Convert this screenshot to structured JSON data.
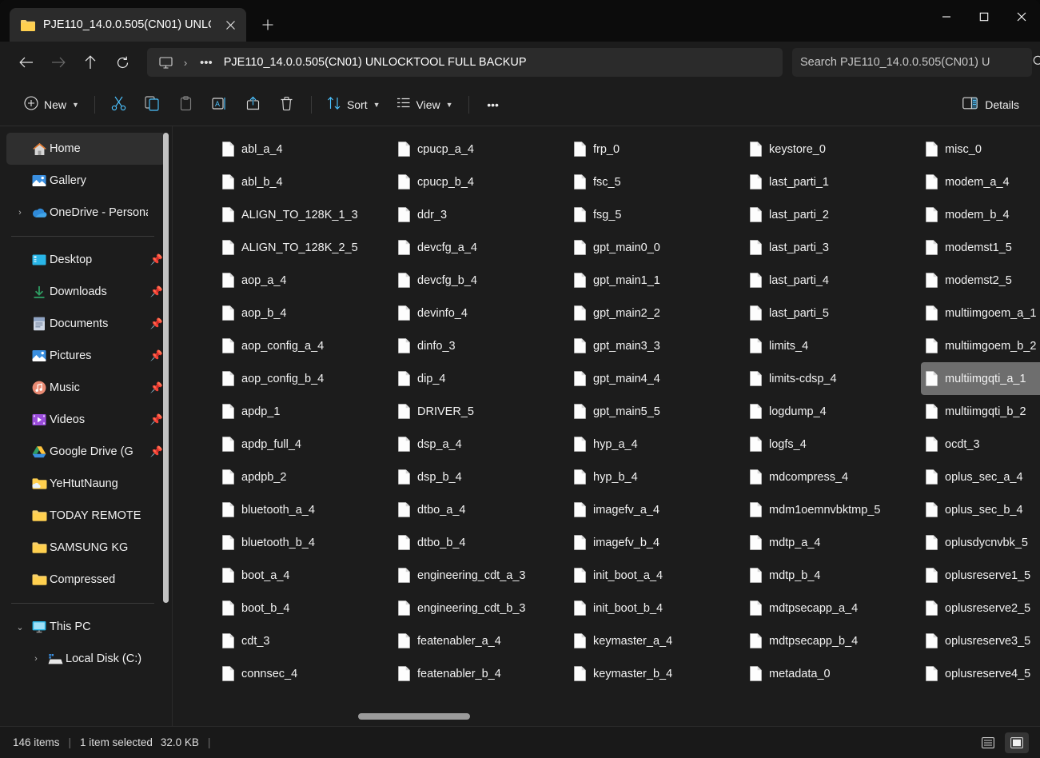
{
  "window": {
    "tab": {
      "title": "PJE110_14.0.0.505(CN01) UNLO",
      "folder_icon": "folder-icon",
      "close_icon": "close-icon"
    },
    "new_tab_label": "+",
    "controls": {
      "minimize": "minimize-icon",
      "maximize": "maximize-icon",
      "close": "close-icon"
    }
  },
  "nav": {
    "back": "arrow-left-icon",
    "forward": "arrow-right-icon",
    "up": "arrow-up-icon",
    "refresh": "refresh-icon",
    "breadcrumb_icon": "this-pc-icon",
    "breadcrumb_sep": "›",
    "breadcrumb_overflow": "•••",
    "breadcrumb_text": "PJE110_14.0.0.505(CN01) UNLOCKTOOL FULL BACKUP",
    "search_placeholder": "Search PJE110_14.0.0.505(CN01) U",
    "search_value": ""
  },
  "toolbar": {
    "new_label": "New",
    "cut_label": "Cut",
    "copy_label": "Copy",
    "paste_label": "Paste",
    "rename_label": "Rename",
    "share_label": "Share",
    "delete_label": "Delete",
    "sort_label": "Sort",
    "view_label": "View",
    "more_label": "•••",
    "details_label": "Details"
  },
  "sidebar": {
    "groups": [
      {
        "items": [
          {
            "label": "Home",
            "icon": "home-icon",
            "selected": true,
            "chevron": "",
            "pinned": false
          },
          {
            "label": "Gallery",
            "icon": "gallery-icon",
            "selected": false,
            "chevron": "",
            "pinned": false
          },
          {
            "label": "OneDrive - Persona",
            "icon": "onedrive-icon",
            "selected": false,
            "chevron": "›",
            "pinned": false
          }
        ]
      },
      {
        "items": [
          {
            "label": "Desktop",
            "icon": "desktop-icon",
            "selected": false,
            "chevron": "",
            "pinned": true
          },
          {
            "label": "Downloads",
            "icon": "downloads-icon",
            "selected": false,
            "chevron": "",
            "pinned": true
          },
          {
            "label": "Documents",
            "icon": "documents-icon",
            "selected": false,
            "chevron": "",
            "pinned": true
          },
          {
            "label": "Pictures",
            "icon": "pictures-icon",
            "selected": false,
            "chevron": "",
            "pinned": true
          },
          {
            "label": "Music",
            "icon": "music-icon",
            "selected": false,
            "chevron": "",
            "pinned": true
          },
          {
            "label": "Videos",
            "icon": "videos-icon",
            "selected": false,
            "chevron": "",
            "pinned": true
          },
          {
            "label": "Google Drive (G",
            "icon": "google-drive-icon",
            "selected": false,
            "chevron": "",
            "pinned": true
          },
          {
            "label": "YeHtutNaung",
            "icon": "onedrive-folder-icon",
            "selected": false,
            "chevron": "",
            "pinned": false
          },
          {
            "label": "TODAY REMOTE",
            "icon": "folder-icon",
            "selected": false,
            "chevron": "",
            "pinned": false
          },
          {
            "label": "SAMSUNG KG",
            "icon": "folder-icon",
            "selected": false,
            "chevron": "",
            "pinned": false
          },
          {
            "label": "Compressed",
            "icon": "folder-icon",
            "selected": false,
            "chevron": "",
            "pinned": false
          }
        ]
      },
      {
        "items": [
          {
            "label": "This PC",
            "icon": "this-pc-icon",
            "selected": false,
            "chevron": "⌄",
            "pinned": false
          },
          {
            "label": "Local Disk (C:)",
            "icon": "disk-icon",
            "selected": false,
            "chevron": "›",
            "pinned": false,
            "indent": true
          }
        ]
      }
    ]
  },
  "files": {
    "columns": [
      [
        "abl_a_4",
        "abl_b_4",
        "ALIGN_TO_128K_1_3",
        "ALIGN_TO_128K_2_5",
        "aop_a_4",
        "aop_b_4",
        "aop_config_a_4",
        "aop_config_b_4",
        "apdp_1",
        "apdp_full_4",
        "apdpb_2",
        "bluetooth_a_4",
        "bluetooth_b_4",
        "boot_a_4",
        "boot_b_4",
        "cdt_3",
        "connsec_4"
      ],
      [
        "cpucp_a_4",
        "cpucp_b_4",
        "ddr_3",
        "devcfg_a_4",
        "devcfg_b_4",
        "devinfo_4",
        "dinfo_3",
        "dip_4",
        "DRIVER_5",
        "dsp_a_4",
        "dsp_b_4",
        "dtbo_a_4",
        "dtbo_b_4",
        "engineering_cdt_a_3",
        "engineering_cdt_b_3",
        "featenabler_a_4",
        "featenabler_b_4"
      ],
      [
        "frp_0",
        "fsc_5",
        "fsg_5",
        "gpt_main0_0",
        "gpt_main1_1",
        "gpt_main2_2",
        "gpt_main3_3",
        "gpt_main4_4",
        "gpt_main5_5",
        "hyp_a_4",
        "hyp_b_4",
        "imagefv_a_4",
        "imagefv_b_4",
        "init_boot_a_4",
        "init_boot_b_4",
        "keymaster_a_4",
        "keymaster_b_4"
      ],
      [
        "keystore_0",
        "last_parti_1",
        "last_parti_2",
        "last_parti_3",
        "last_parti_4",
        "last_parti_5",
        "limits_4",
        "limits-cdsp_4",
        "logdump_4",
        "logfs_4",
        "mdcompress_4",
        "mdm1oemnvbktmp_5",
        "mdtp_a_4",
        "mdtp_b_4",
        "mdtpsecapp_a_4",
        "mdtpsecapp_b_4",
        "metadata_0"
      ],
      [
        "misc_0",
        "modem_a_4",
        "modem_b_4",
        "modemst1_5",
        "modemst2_5",
        "multiimgoem_a_1",
        "multiimgoem_b_2",
        "multiimgqti_a_1",
        "multiimgqti_b_2",
        "ocdt_3",
        "oplus_sec_a_4",
        "oplus_sec_b_4",
        "oplusdycnvbk_5",
        "oplusreserve1_5",
        "oplusreserve2_5",
        "oplusreserve3_5",
        "oplusreserve4_5"
      ]
    ],
    "selected": "multiimgqti_a_1"
  },
  "status": {
    "item_count": "146 items",
    "divider": "|",
    "selection": "1 item selected",
    "size": "32.0 KB",
    "trailing_divider": "|",
    "view_details_icon": "details-view-icon",
    "view_icons_icon": "large-icons-view-icon"
  },
  "colors": {
    "window_bg": "#1c1c1c",
    "titlebar_bg": "#0c0c0c",
    "tab_bg": "#2b2b2b",
    "selection": "#6e6e6e",
    "accent": "#4cc2ff",
    "text": "#f2f2f2"
  }
}
